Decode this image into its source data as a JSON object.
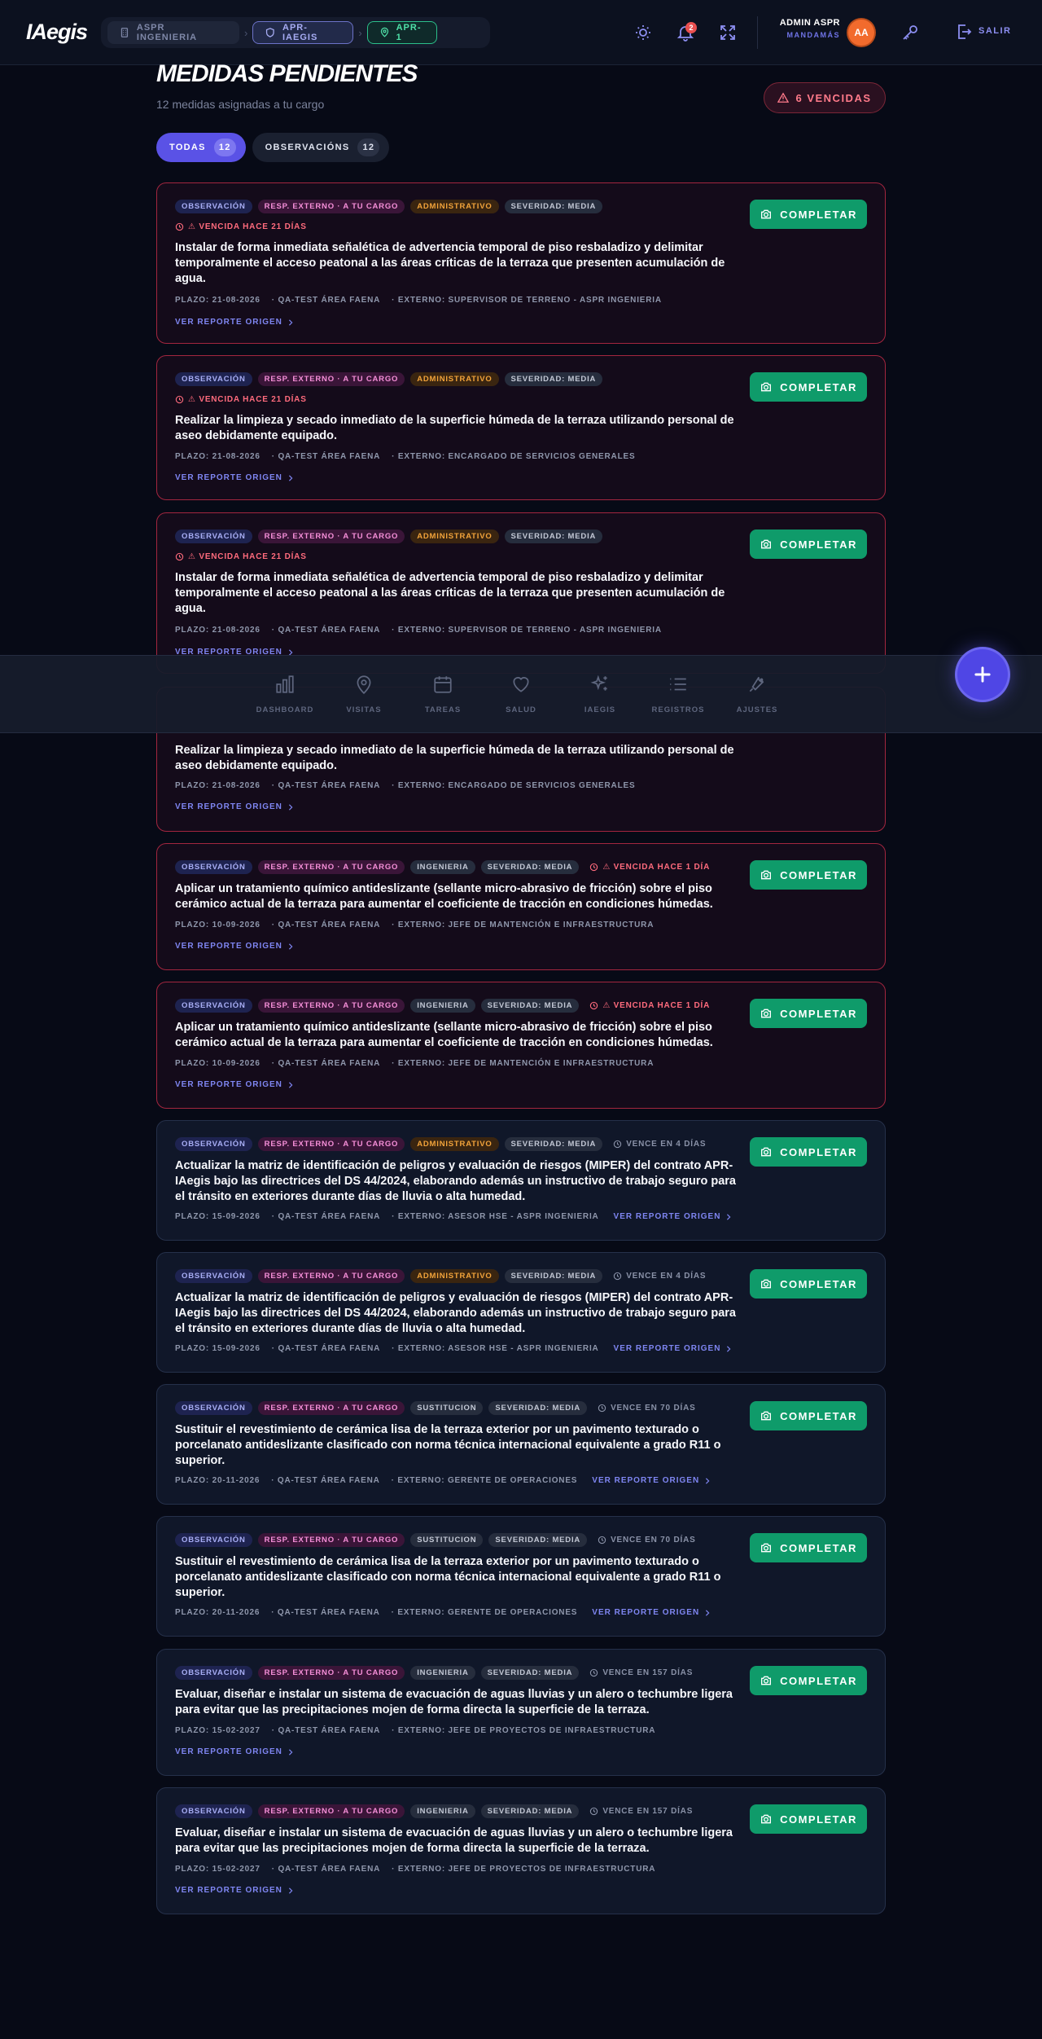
{
  "app": {
    "logo": "IAegis"
  },
  "breadcrumb": [
    "ASPR INGENIERIA",
    "APR-IAEGIS",
    "APR-1"
  ],
  "header": {
    "notifications": "2",
    "user_name": "ADMIN ASPR",
    "user_role": "MANDAMÁS",
    "avatar": "AA",
    "logout": "SALIR"
  },
  "page": {
    "title": "MEDIDAS PENDIENTES",
    "subtitle": "12 medidas asignadas a tu cargo",
    "overdue_badge": "6 VENCIDAS"
  },
  "filters": [
    {
      "label": "TODAS",
      "count": "12",
      "active": true
    },
    {
      "label": "OBSERVACIÓNS",
      "count": "12",
      "active": false
    }
  ],
  "complete_label": "COMPLETAR",
  "link_label": "VER REPORTE ORIGEN",
  "cards": [
    {
      "tags": [
        "OBSERVACIÓN",
        "RESP. EXTERNO · A TU CARGO",
        "ADMINISTRATIVO",
        "SEVERIDAD: MEDIA"
      ],
      "due": "⚠ VENCIDA HACE 21 DÍAS",
      "overdue": true,
      "desc": "Instalar de forma inmediata señalética de advertencia temporal de piso resbaladizo y delimitar temporalmente el acceso peatonal a las áreas críticas de la terraza que presenten acumulación de agua.",
      "plazo": "PLAZO: 21-08-2026",
      "area": "· QA-TEST ÁREA FAENA",
      "externo": "· EXTERNO: SUPERVISOR DE TERRENO - ASPR INGENIERIA"
    },
    {
      "tags": [
        "OBSERVACIÓN",
        "RESP. EXTERNO · A TU CARGO",
        "ADMINISTRATIVO",
        "SEVERIDAD: MEDIA"
      ],
      "due": "⚠ VENCIDA HACE 21 DÍAS",
      "overdue": true,
      "desc": "Realizar la limpieza y secado inmediato de la superficie húmeda de la terraza utilizando personal de aseo debidamente equipado.",
      "plazo": "PLAZO: 21-08-2026",
      "area": "· QA-TEST ÁREA FAENA",
      "externo": "· EXTERNO: ENCARGADO DE SERVICIOS GENERALES"
    },
    {
      "tags": [
        "OBSERVACIÓN",
        "RESP. EXTERNO · A TU CARGO",
        "ADMINISTRATIVO",
        "SEVERIDAD: MEDIA"
      ],
      "due": "⚠ VENCIDA HACE 21 DÍAS",
      "overdue": true,
      "desc": "Instalar de forma inmediata señalética de advertencia temporal de piso resbaladizo y delimitar temporalmente el acceso peatonal a las áreas críticas de la terraza que presenten acumulación de agua.",
      "plazo": "PLAZO: 21-08-2026",
      "area": "· QA-TEST ÁREA FAENA",
      "externo": "· EXTERNO: SUPERVISOR DE TERRENO - ASPR INGENIERIA"
    },
    {
      "tags": [],
      "due": "",
      "overdue": true,
      "desc": "Realizar la limpieza y secado inmediato de la superficie húmeda de la terraza utilizando personal de aseo debidamente equipado.",
      "plazo": "PLAZO: 21-08-2026",
      "area": "· QA-TEST ÁREA FAENA",
      "externo": "· EXTERNO: ENCARGADO DE SERVICIOS GENERALES"
    },
    {
      "tags": [
        "OBSERVACIÓN",
        "RESP. EXTERNO · A TU CARGO",
        "INGENIERIA",
        "SEVERIDAD: MEDIA"
      ],
      "due": "⚠ VENCIDA HACE 1 DÍA",
      "overdue": true,
      "desc": "Aplicar un tratamiento químico antideslizante (sellante micro-abrasivo de fricción) sobre el piso cerámico actual de la terraza para aumentar el coeficiente de tracción en condiciones húmedas.",
      "plazo": "PLAZO: 10-09-2026",
      "area": "· QA-TEST ÁREA FAENA",
      "externo": "· EXTERNO: JEFE DE MANTENCIÓN E INFRAESTRUCTURA"
    },
    {
      "tags": [
        "OBSERVACIÓN",
        "RESP. EXTERNO · A TU CARGO",
        "INGENIERIA",
        "SEVERIDAD: MEDIA"
      ],
      "due": "⚠ VENCIDA HACE 1 DÍA",
      "overdue": true,
      "desc": "Aplicar un tratamiento químico antideslizante (sellante micro-abrasivo de fricción) sobre el piso cerámico actual de la terraza para aumentar el coeficiente de tracción en condiciones húmedas.",
      "plazo": "PLAZO: 10-09-2026",
      "area": "· QA-TEST ÁREA FAENA",
      "externo": "· EXTERNO: JEFE DE MANTENCIÓN E INFRAESTRUCTURA"
    },
    {
      "tags": [
        "OBSERVACIÓN",
        "RESP. EXTERNO · A TU CARGO",
        "ADMINISTRATIVO",
        "SEVERIDAD: MEDIA"
      ],
      "due": "VENCE EN 4 DÍAS",
      "overdue": false,
      "desc": "Actualizar la matriz de identificación de peligros y evaluación de riesgos (MIPER) del contrato APR-IAegis bajo las directrices del DS 44/2024, elaborando además un instructivo de trabajo seguro para el tránsito en exteriores durante días de lluvia o alta humedad.",
      "plazo": "PLAZO: 15-09-2026",
      "area": "· QA-TEST ÁREA FAENA",
      "externo": "· EXTERNO: ASESOR HSE - ASPR INGENIERIA"
    },
    {
      "tags": [
        "OBSERVACIÓN",
        "RESP. EXTERNO · A TU CARGO",
        "ADMINISTRATIVO",
        "SEVERIDAD: MEDIA"
      ],
      "due": "VENCE EN 4 DÍAS",
      "overdue": false,
      "desc": "Actualizar la matriz de identificación de peligros y evaluación de riesgos (MIPER) del contrato APR-IAegis bajo las directrices del DS 44/2024, elaborando además un instructivo de trabajo seguro para el tránsito en exteriores durante días de lluvia o alta humedad.",
      "plazo": "PLAZO: 15-09-2026",
      "area": "· QA-TEST ÁREA FAENA",
      "externo": "· EXTERNO: ASESOR HSE - ASPR INGENIERIA"
    },
    {
      "tags": [
        "OBSERVACIÓN",
        "RESP. EXTERNO · A TU CARGO",
        "SUSTITUCION",
        "SEVERIDAD: MEDIA"
      ],
      "due": "VENCE EN 70 DÍAS",
      "overdue": false,
      "desc": "Sustituir el revestimiento de cerámica lisa de la terraza exterior por un pavimento texturado o porcelanato antideslizante clasificado con norma técnica internacional equivalente a grado R11 o superior.",
      "plazo": "PLAZO: 20-11-2026",
      "area": "· QA-TEST ÁREA FAENA",
      "externo": "· EXTERNO: GERENTE DE OPERACIONES"
    },
    {
      "tags": [
        "OBSERVACIÓN",
        "RESP. EXTERNO · A TU CARGO",
        "SUSTITUCION",
        "SEVERIDAD: MEDIA"
      ],
      "due": "VENCE EN 70 DÍAS",
      "overdue": false,
      "desc": "Sustituir el revestimiento de cerámica lisa de la terraza exterior por un pavimento texturado o porcelanato antideslizante clasificado con norma técnica internacional equivalente a grado R11 o superior.",
      "plazo": "PLAZO: 20-11-2026",
      "area": "· QA-TEST ÁREA FAENA",
      "externo": "· EXTERNO: GERENTE DE OPERACIONES"
    },
    {
      "tags": [
        "OBSERVACIÓN",
        "RESP. EXTERNO · A TU CARGO",
        "INGENIERIA",
        "SEVERIDAD: MEDIA"
      ],
      "due": "VENCE EN 157 DÍAS",
      "overdue": false,
      "desc": "Evaluar, diseñar e instalar un sistema de evacuación de aguas lluvias y un alero o techumbre ligera para evitar que las precipitaciones mojen de forma directa la superficie de la terraza.",
      "plazo": "PLAZO: 15-02-2027",
      "area": "· QA-TEST ÁREA FAENA",
      "externo": "· EXTERNO: JEFE DE PROYECTOS DE INFRAESTRUCTURA"
    },
    {
      "tags": [
        "OBSERVACIÓN",
        "RESP. EXTERNO · A TU CARGO",
        "INGENIERIA",
        "SEVERIDAD: MEDIA"
      ],
      "due": "VENCE EN 157 DÍAS",
      "overdue": false,
      "desc": "Evaluar, diseñar e instalar un sistema de evacuación de aguas lluvias y un alero o techumbre ligera para evitar que las precipitaciones mojen de forma directa la superficie de la terraza.",
      "plazo": "PLAZO: 15-02-2027",
      "area": "· QA-TEST ÁREA FAENA",
      "externo": "· EXTERNO: JEFE DE PROYECTOS DE INFRAESTRUCTURA"
    }
  ],
  "nav": [
    "DASHBOARD",
    "VISITAS",
    "TAREAS",
    "SALUD",
    "IAEGIS",
    "REGISTROS",
    "AJUSTES"
  ],
  "colors": {
    "accent": "#5a52e6",
    "complete": "#0f9b6a",
    "overdue": "#ff6b7d",
    "background": "#070a16"
  },
  "icons": {
    "theme": "sun-icon",
    "notifications": "bell-icon",
    "fullscreen": "expand-icon",
    "key": "key-icon",
    "logout": "logout-icon",
    "fab": "plus-icon"
  }
}
